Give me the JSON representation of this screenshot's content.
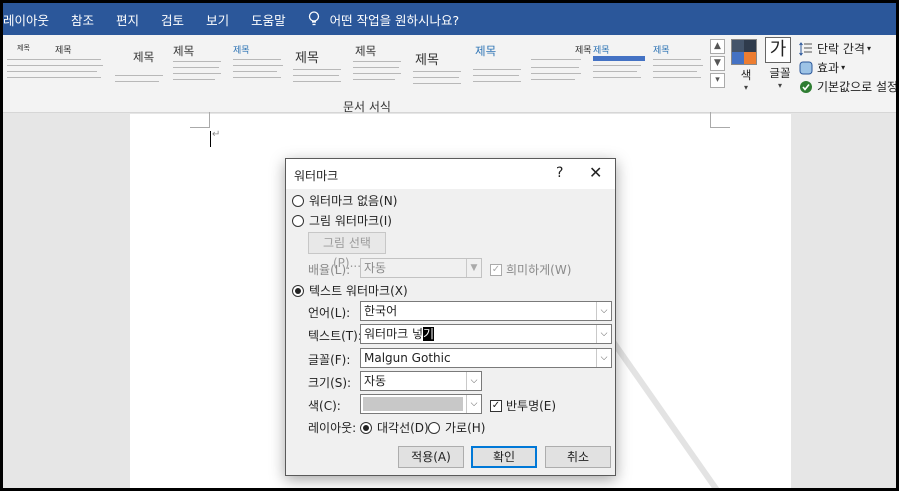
{
  "menu": {
    "items": [
      "레이아웃",
      "참조",
      "편지",
      "검토",
      "보기",
      "도움말"
    ],
    "tell_me": "어떤 작업을 원하시나요?"
  },
  "ribbon": {
    "style_thumbs": [
      {
        "title": "제목"
      },
      {
        "title": "제목"
      },
      {
        "title": "제목"
      },
      {
        "title": "제목"
      },
      {
        "title": "제목"
      },
      {
        "title": "제목"
      },
      {
        "title": "제목"
      },
      {
        "title": "제목"
      },
      {
        "title": "제목"
      },
      {
        "title": "제목"
      },
      {
        "title": "제목"
      },
      {
        "title": "제목"
      }
    ],
    "group_label": "문서 서식",
    "colors_label": "색",
    "fonts_label": "글꼴",
    "font_glyph": "가",
    "paragraph_spacing": "단락 간격",
    "effects": "효과",
    "set_default": "기본값으로 설정"
  },
  "dialog": {
    "title": "워터마크",
    "help": "?",
    "close": "✕",
    "no_watermark": "워터마크 없음(N)",
    "picture_watermark": "그림 워터마크(I)",
    "select_picture": "그림 선택(P)...",
    "scale_label": "배율(L):",
    "scale_value": "자동",
    "washout_label": "희미하게(W)",
    "text_watermark": "텍스트 워터마크(X)",
    "language_label": "언어(L):",
    "language_value": "한국어",
    "text_label": "텍스트(T):",
    "text_value_prefix": "워터마크 넣",
    "text_value_selected": "기",
    "font_label": "글꼴(F):",
    "font_value": "Malgun Gothic",
    "size_label": "크기(S):",
    "size_value": "자동",
    "color_label": "색(C):",
    "semitransparent_label": "반투명(E)",
    "layout_label": "레이아웃:",
    "diagonal_label": "대각선(D)",
    "horizontal_label": "가로(H)",
    "apply_button": "적용(A)",
    "ok_button": "확인",
    "cancel_button": "취소",
    "selected_option": "text_watermark",
    "layout_selected": "diagonal",
    "semitransparent_checked": true,
    "washout_checked": true
  }
}
